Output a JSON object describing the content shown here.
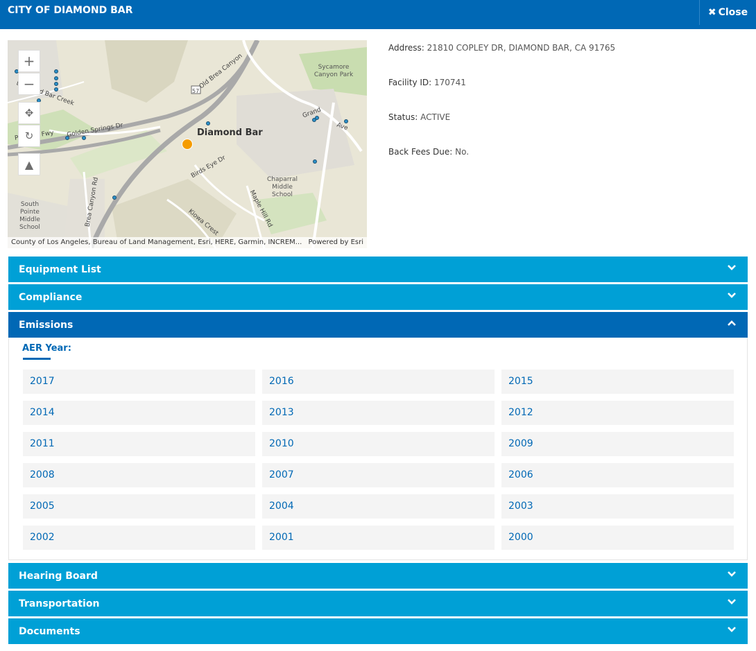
{
  "header": {
    "title": "CITY OF DIAMOND BAR",
    "close_label": "Close"
  },
  "map": {
    "attribution": "County of Los Angeles, Bureau of Land Management, Esri, HERE, Garmin, INCREM...",
    "powered_by": "Powered by Esri",
    "labels": {
      "city": "Diamond Bar",
      "park": "Sycamore Canyon Park",
      "school1": "Chaparral Middle School",
      "school2": "South Pointe Middle School",
      "road_oldbrea": "Old Brea Canyon",
      "road_golden": "Golden Springs Dr",
      "road_pomona": "Pomona Fwy",
      "road_birds": "Birds Eye Dr",
      "road_maple": "Maple Hill Rd",
      "road_kiowa": "Kiowa Crest",
      "road_brea": "Brea Canyon Rd",
      "road_grand": "Grand",
      "road_ave": "Ave",
      "road_creek": "Diamond Bar Creek",
      "shield": "57"
    },
    "marker_color": "#f59c00"
  },
  "info": {
    "address_label": "Address:",
    "address_value": "21810 COPLEY DR, DIAMOND BAR, CA 91765",
    "facility_label": "Facility ID:",
    "facility_value": "170741",
    "status_label": "Status:",
    "status_value": "ACTIVE",
    "fees_label": "Back Fees Due:",
    "fees_value": "No."
  },
  "sections": {
    "equipment": "Equipment List",
    "compliance": "Compliance",
    "emissions": "Emissions",
    "hearing": "Hearing Board",
    "transportation": "Transportation",
    "documents": "Documents"
  },
  "emissions": {
    "aer_label": "AER Year:",
    "years": [
      "2017",
      "2016",
      "2015",
      "2014",
      "2013",
      "2012",
      "2011",
      "2010",
      "2009",
      "2008",
      "2007",
      "2006",
      "2005",
      "2004",
      "2003",
      "2002",
      "2001",
      "2000"
    ]
  },
  "colors": {
    "header": "#0068b5",
    "section": "#00a0d6",
    "section_open": "#0068b5"
  }
}
